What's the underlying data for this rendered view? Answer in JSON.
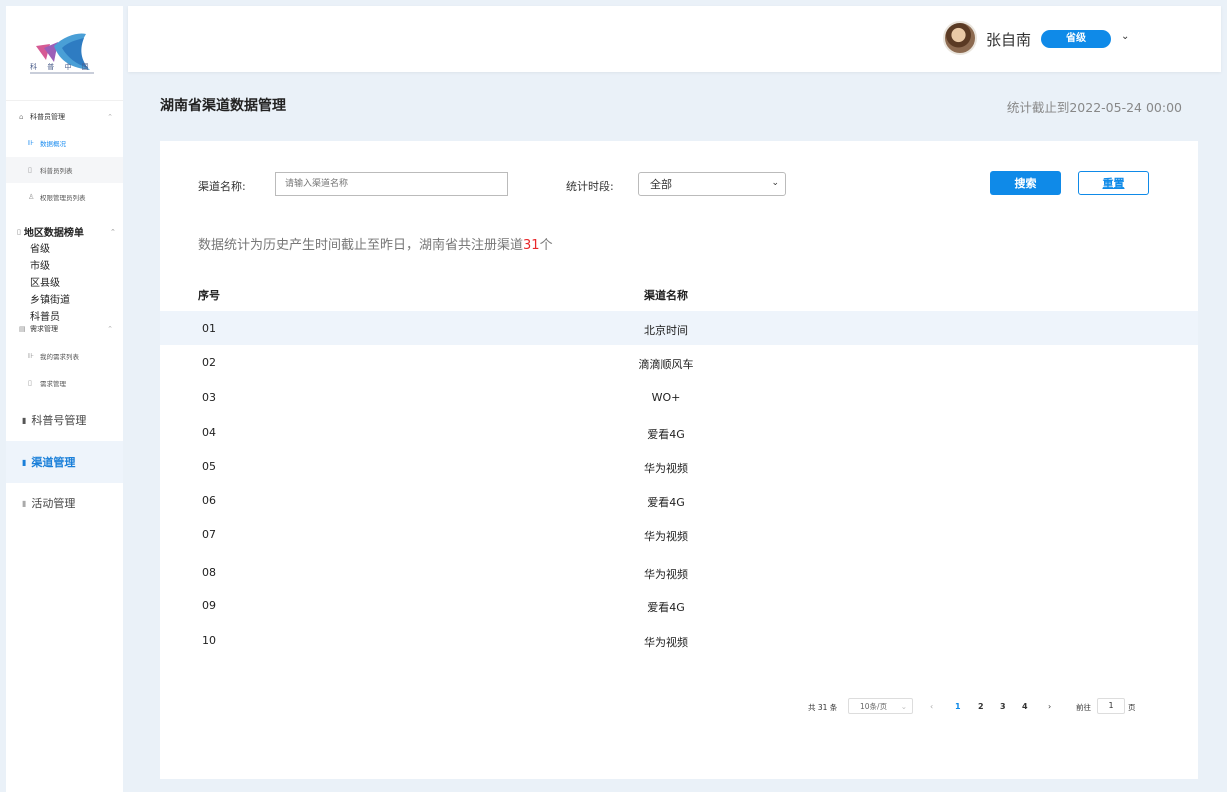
{
  "sidebar": {
    "logo_text": "科 普 中 国",
    "group1": {
      "label": "科普员管理",
      "items": [
        "数据概况",
        "科普员列表",
        "权限管理员列表"
      ]
    },
    "region": {
      "label": "地区数据榜单",
      "items": [
        "省级",
        "市级",
        "区县级",
        "乡镇街道",
        "科普员"
      ]
    },
    "group2": {
      "label": "需求管理",
      "items": [
        "我的需求列表",
        "需求管理"
      ]
    },
    "big_nav": [
      "科普号管理",
      "渠道管理",
      "活动管理"
    ]
  },
  "header": {
    "username": "张自南",
    "level": "省级"
  },
  "page": {
    "title": "湖南省渠道数据管理",
    "stat_time": "统计截止到2022-05-24 00:00"
  },
  "filters": {
    "channel_label": "渠道名称:",
    "channel_placeholder": "请输入渠道名称",
    "period_label": "统计时段:",
    "period_value": "全部",
    "search_button": "搜索",
    "reset_button": "重置"
  },
  "summary": {
    "prefix": "数据统计为历史产生时间截止至昨日，湖南省共注册渠道",
    "count": "31",
    "suffix": "个"
  },
  "table": {
    "headers": [
      "序号",
      "渠道名称"
    ],
    "rows": [
      [
        "01",
        "北京时间"
      ],
      [
        "02",
        "滴滴顺风车"
      ],
      [
        "03",
        "WO+"
      ],
      [
        "04",
        "爱看4G"
      ],
      [
        "05",
        "华为视频"
      ],
      [
        "06",
        "爱看4G"
      ],
      [
        "07",
        "华为视频"
      ],
      [
        "08",
        "华为视频"
      ],
      [
        "09",
        "爱看4G"
      ],
      [
        "10",
        "华为视频"
      ]
    ]
  },
  "pagination": {
    "total": "共 31 条",
    "page_size": "10条/页",
    "pages": [
      "1",
      "2",
      "3",
      "4"
    ],
    "current": "1",
    "goto_label": "前往",
    "goto_value": "1",
    "goto_suffix": "页"
  }
}
